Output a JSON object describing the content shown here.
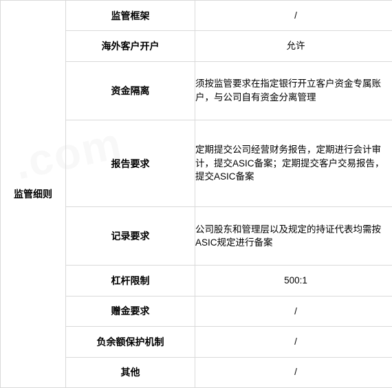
{
  "table": {
    "header_label": "监管细则",
    "accent_color": "#c6d7ef",
    "grid_color": "#d9d9d9",
    "frame_color": "#000000",
    "watermark_text": ".com",
    "rows": [
      {
        "label": "监管框架",
        "value": "/",
        "align": "center"
      },
      {
        "label": "海外客户开户",
        "value": "允许",
        "align": "center"
      },
      {
        "label": "资金隔离",
        "value": "须按监管要求在指定银行开立客户资金专属账户，与公司自有资金分离管理",
        "align": "left"
      },
      {
        "label": "报告要求",
        "value": "定期提交公司经营财务报告，定期进行会计审计，提交ASIC备案；定期提交客户交易报告，提交ASIC备案",
        "align": "left"
      },
      {
        "label": "记录要求",
        "value": "公司股东和管理层以及规定的持证代表均需按ASIC规定进行备案",
        "align": "left"
      },
      {
        "label": "杠杆限制",
        "value": "500:1",
        "align": "center"
      },
      {
        "label": "赠金要求",
        "value": "/",
        "align": "center"
      },
      {
        "label": "负余额保护机制",
        "value": "/",
        "align": "center"
      },
      {
        "label": "其他",
        "value": "/",
        "align": "center"
      }
    ]
  }
}
